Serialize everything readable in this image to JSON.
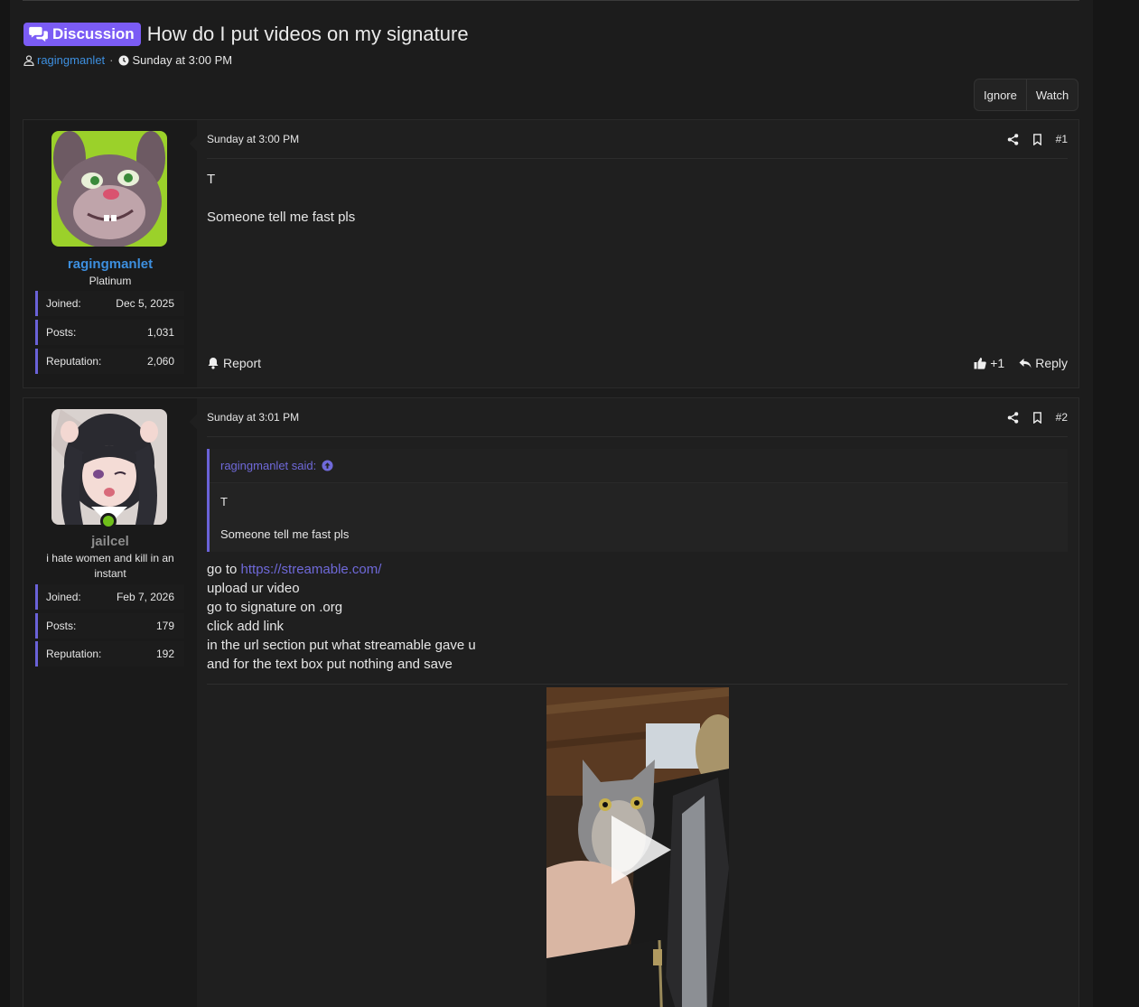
{
  "thread": {
    "prefix_label": "Discussion",
    "title": "How do I put videos on my signature",
    "author": "ragingmanlet",
    "separator": "·",
    "time": "Sunday at 3:00 PM"
  },
  "thread_buttons": {
    "ignore": "Ignore",
    "watch": "Watch"
  },
  "posts": [
    {
      "user": {
        "name": "ragingmanlet",
        "name_color": "#3d8fdf",
        "title": "Platinum",
        "stats": [
          {
            "label": "Joined:",
            "value": "Dec 5, 2025"
          },
          {
            "label": "Posts:",
            "value": "1,031"
          },
          {
            "label": "Reputation:",
            "value": "2,060"
          }
        ]
      },
      "date": "Sunday at 3:00 PM",
      "number": "#1",
      "body": [
        "T",
        "Someone tell me fast pls"
      ],
      "report_label": "Report",
      "reaction_count": "+1",
      "reply_label": "Reply"
    },
    {
      "user": {
        "name": "jailcel",
        "name_color": "#8c8c8c",
        "title": "i hate women and kill in an instant",
        "online": true,
        "stats": [
          {
            "label": "Joined:",
            "value": "Feb 7, 2026"
          },
          {
            "label": "Posts:",
            "value": "179"
          },
          {
            "label": "Reputation:",
            "value": "192"
          }
        ]
      },
      "date": "Sunday at 3:01 PM",
      "number": "#2",
      "quote": {
        "author_said": "ragingmanlet said:",
        "lines": [
          "T",
          "Someone tell me fast pls"
        ]
      },
      "body_lines": [
        {
          "prefix": "go to ",
          "link": "https://streamable.com/"
        },
        {
          "text": "upload ur video"
        },
        {
          "text": "go to signature on .org"
        },
        {
          "text": "click add link"
        },
        {
          "text": "in the url section put what streamable gave u"
        },
        {
          "text": "and for the text box put nothing and save"
        }
      ]
    }
  ],
  "colors": {
    "accent": "#7b5cf5",
    "link": "#6f69d9",
    "username_blue": "#3d8fdf",
    "online_dot": "#6fbf1a"
  },
  "icons": [
    "comments-icon",
    "user-icon",
    "clock-icon",
    "share-icon",
    "bookmark-icon",
    "bell-icon",
    "thumbs-up-icon",
    "reply-icon",
    "quote-arrow-icon",
    "play-icon"
  ]
}
